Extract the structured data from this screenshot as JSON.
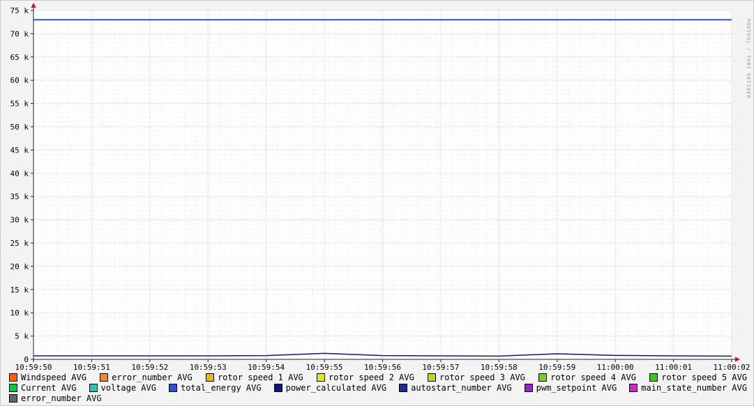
{
  "watermark": "RRDTOOL / TOBI OETIKER",
  "chart_data": {
    "type": "line",
    "title": "",
    "xlabel": "",
    "ylabel": "",
    "ylim": [
      0,
      75000
    ],
    "grid": {
      "major_color": "#f5b4b4",
      "minor_color": "#ebebeb",
      "axis_color": "#222222",
      "arrow_color": "#cc1111",
      "plot_bg": "#ffffff",
      "outer_bg": "#f3f3f3"
    },
    "x_ticks": [
      "10:59:50",
      "10:59:51",
      "10:59:52",
      "10:59:53",
      "10:59:54",
      "10:59:55",
      "10:59:56",
      "10:59:57",
      "10:59:58",
      "10:59:59",
      "11:00:00",
      "11:00:01",
      "11:00:02"
    ],
    "y_ticks": [
      {
        "value": 75000,
        "label": "75 k"
      },
      {
        "value": 70000,
        "label": "70 k"
      },
      {
        "value": 65000,
        "label": "65 k"
      },
      {
        "value": 60000,
        "label": "60 k"
      },
      {
        "value": 55000,
        "label": "55 k"
      },
      {
        "value": 50000,
        "label": "50 k"
      },
      {
        "value": 45000,
        "label": "45 k"
      },
      {
        "value": 40000,
        "label": "40 k"
      },
      {
        "value": 35000,
        "label": "35 k"
      },
      {
        "value": 30000,
        "label": "30 k"
      },
      {
        "value": 25000,
        "label": "25 k"
      },
      {
        "value": 20000,
        "label": "20 k"
      },
      {
        "value": 15000,
        "label": "15 k"
      },
      {
        "value": 10000,
        "label": "10 k"
      },
      {
        "value": 5000,
        "label": "5 k"
      },
      {
        "value": 0,
        "label": "0"
      }
    ],
    "series": [
      {
        "name": "total_energy AVG",
        "color": "#2a52cc",
        "width": 2,
        "values": [
          73000,
          73000,
          73000,
          73000,
          73000,
          73000,
          73000,
          73000,
          73000,
          73000,
          73000,
          73000,
          73000
        ]
      },
      {
        "name": "power_calculated AVG",
        "color": "#101672",
        "width": 1.5,
        "values": [
          750,
          750,
          750,
          750,
          800,
          1300,
          800,
          750,
          700,
          1200,
          850,
          750,
          700
        ]
      }
    ]
  },
  "legend": {
    "rows": [
      [
        {
          "label": "Windspeed AVG",
          "color": "#f6600f"
        },
        {
          "label": "error_number AVG",
          "color": "#e98c23"
        },
        {
          "label": "rotor speed 1 AVG",
          "color": "#e3b71e"
        },
        {
          "label": "rotor speed 2 AVG",
          "color": "#e6e322"
        },
        {
          "label": "rotor speed 3 AVG",
          "color": "#b4dc1f"
        },
        {
          "label": "rotor speed 4 AVG",
          "color": "#7acc1e"
        },
        {
          "label": "rotor speed 5 AVG",
          "color": "#3fc41f"
        }
      ],
      [
        {
          "label": "Current AVG",
          "color": "#12c045"
        },
        {
          "label": "voltage AVG",
          "color": "#2bc8a8"
        },
        {
          "label": "total_energy AVG",
          "color": "#2a52cc"
        },
        {
          "label": "power_calculated AVG",
          "color": "#101672"
        },
        {
          "label": "autostart_number AVG",
          "color": "#26269b"
        },
        {
          "label": "pwm_setpoint AVG",
          "color": "#8a2bcf"
        },
        {
          "label": "main_state_number AVG",
          "color": "#cb2acb"
        }
      ],
      [
        {
          "label": "error_number AVG",
          "color": "#666666"
        }
      ]
    ]
  }
}
